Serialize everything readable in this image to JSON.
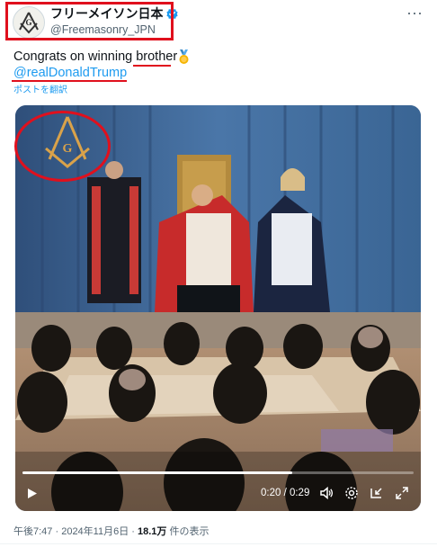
{
  "account": {
    "display_name": "フリーメイソン日本",
    "handle": "@Freemasonry_JPN"
  },
  "tweet": {
    "text": "Congrats on winning brother",
    "emoji": "medal-icon",
    "mention": "@realDonaldTrump",
    "translate_link": "ポストを翻訳"
  },
  "video": {
    "time_label": "0:20 / 0:29",
    "progress": 0.69,
    "controls": [
      "play-icon",
      "volume-icon",
      "settings-icon",
      "minimize-icon",
      "fullscreen-icon"
    ]
  },
  "meta": {
    "time": "午後7:47",
    "sep1": " · ",
    "date": "2024年11月6日",
    "sep2": " · ",
    "views": "18.1万",
    "views_suffix": " 件の表示"
  },
  "colors": {
    "annotation_red": "#e0101d",
    "link_blue": "#1d9bf0",
    "secondary_text": "#536471"
  }
}
